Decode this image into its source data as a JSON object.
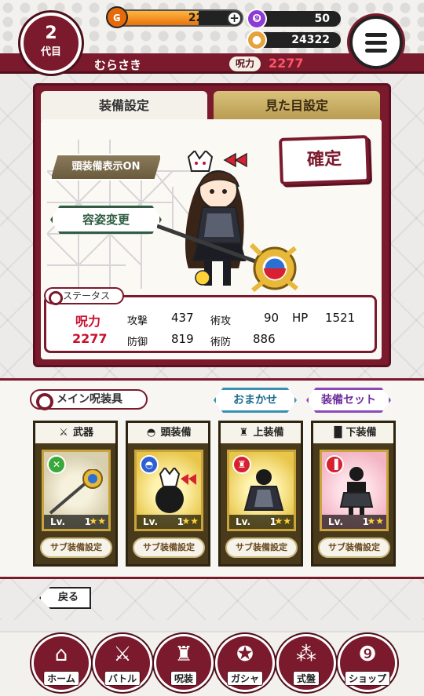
{
  "header": {
    "generation_number": "2",
    "generation_label": "代目",
    "player_name": "むらさき",
    "power_label": "呪力",
    "power_value": "2277",
    "stamina_text": "22/33",
    "stamina_fraction": 0.667,
    "stamina_plus": "+",
    "currency_1": "50",
    "currency_2": "24322"
  },
  "tabs": {
    "equip_settings": "装備設定",
    "appearance_settings": "見た目設定"
  },
  "panel": {
    "head_display_button": "頭装備表示ON",
    "change_appearance_button": "容姿変更",
    "confirm_button": "確定"
  },
  "status": {
    "tab_label": "ステータス",
    "power_label": "呪力",
    "power_value": "2277",
    "attack_label": "攻撃",
    "attack_value": "437",
    "magic_attack_label": "術攻",
    "magic_attack_value": "90",
    "hp_label": "HP",
    "hp_value": "1521",
    "defense_label": "防御",
    "defense_value": "819",
    "magic_defense_label": "術防",
    "magic_defense_value": "886"
  },
  "equipment": {
    "section_label": "メイン呪装具",
    "auto_button": "おまかせ",
    "equip_set_button": "装備セット",
    "slots": [
      {
        "name": "武器",
        "level_label": "Lv.",
        "level": "1",
        "sub_button": "サブ装備設定"
      },
      {
        "name": "頭装備",
        "level_label": "Lv.",
        "level": "1",
        "sub_button": "サブ装備設定"
      },
      {
        "name": "上装備",
        "level_label": "Lv.",
        "level": "1",
        "sub_button": "サブ装備設定"
      },
      {
        "name": "下装備",
        "level_label": "Lv.",
        "level": "1",
        "sub_button": "サブ装備設定"
      }
    ]
  },
  "back_button": "戻る",
  "nav": [
    {
      "label": "ホーム",
      "icon": "home-icon"
    },
    {
      "label": "バトル",
      "icon": "battle-icon"
    },
    {
      "label": "呪装",
      "icon": "armor-icon"
    },
    {
      "label": "ガシャ",
      "icon": "gacha-icon"
    },
    {
      "label": "式盤",
      "icon": "board-icon"
    },
    {
      "label": "ショップ",
      "icon": "shop-icon"
    }
  ],
  "colors": {
    "primary": "#7a1a2c",
    "gold": "#c9a43c",
    "auto_button": "#3b8fb0",
    "equip_set_button": "#8a4ab8",
    "power_text": "#c8102e"
  }
}
